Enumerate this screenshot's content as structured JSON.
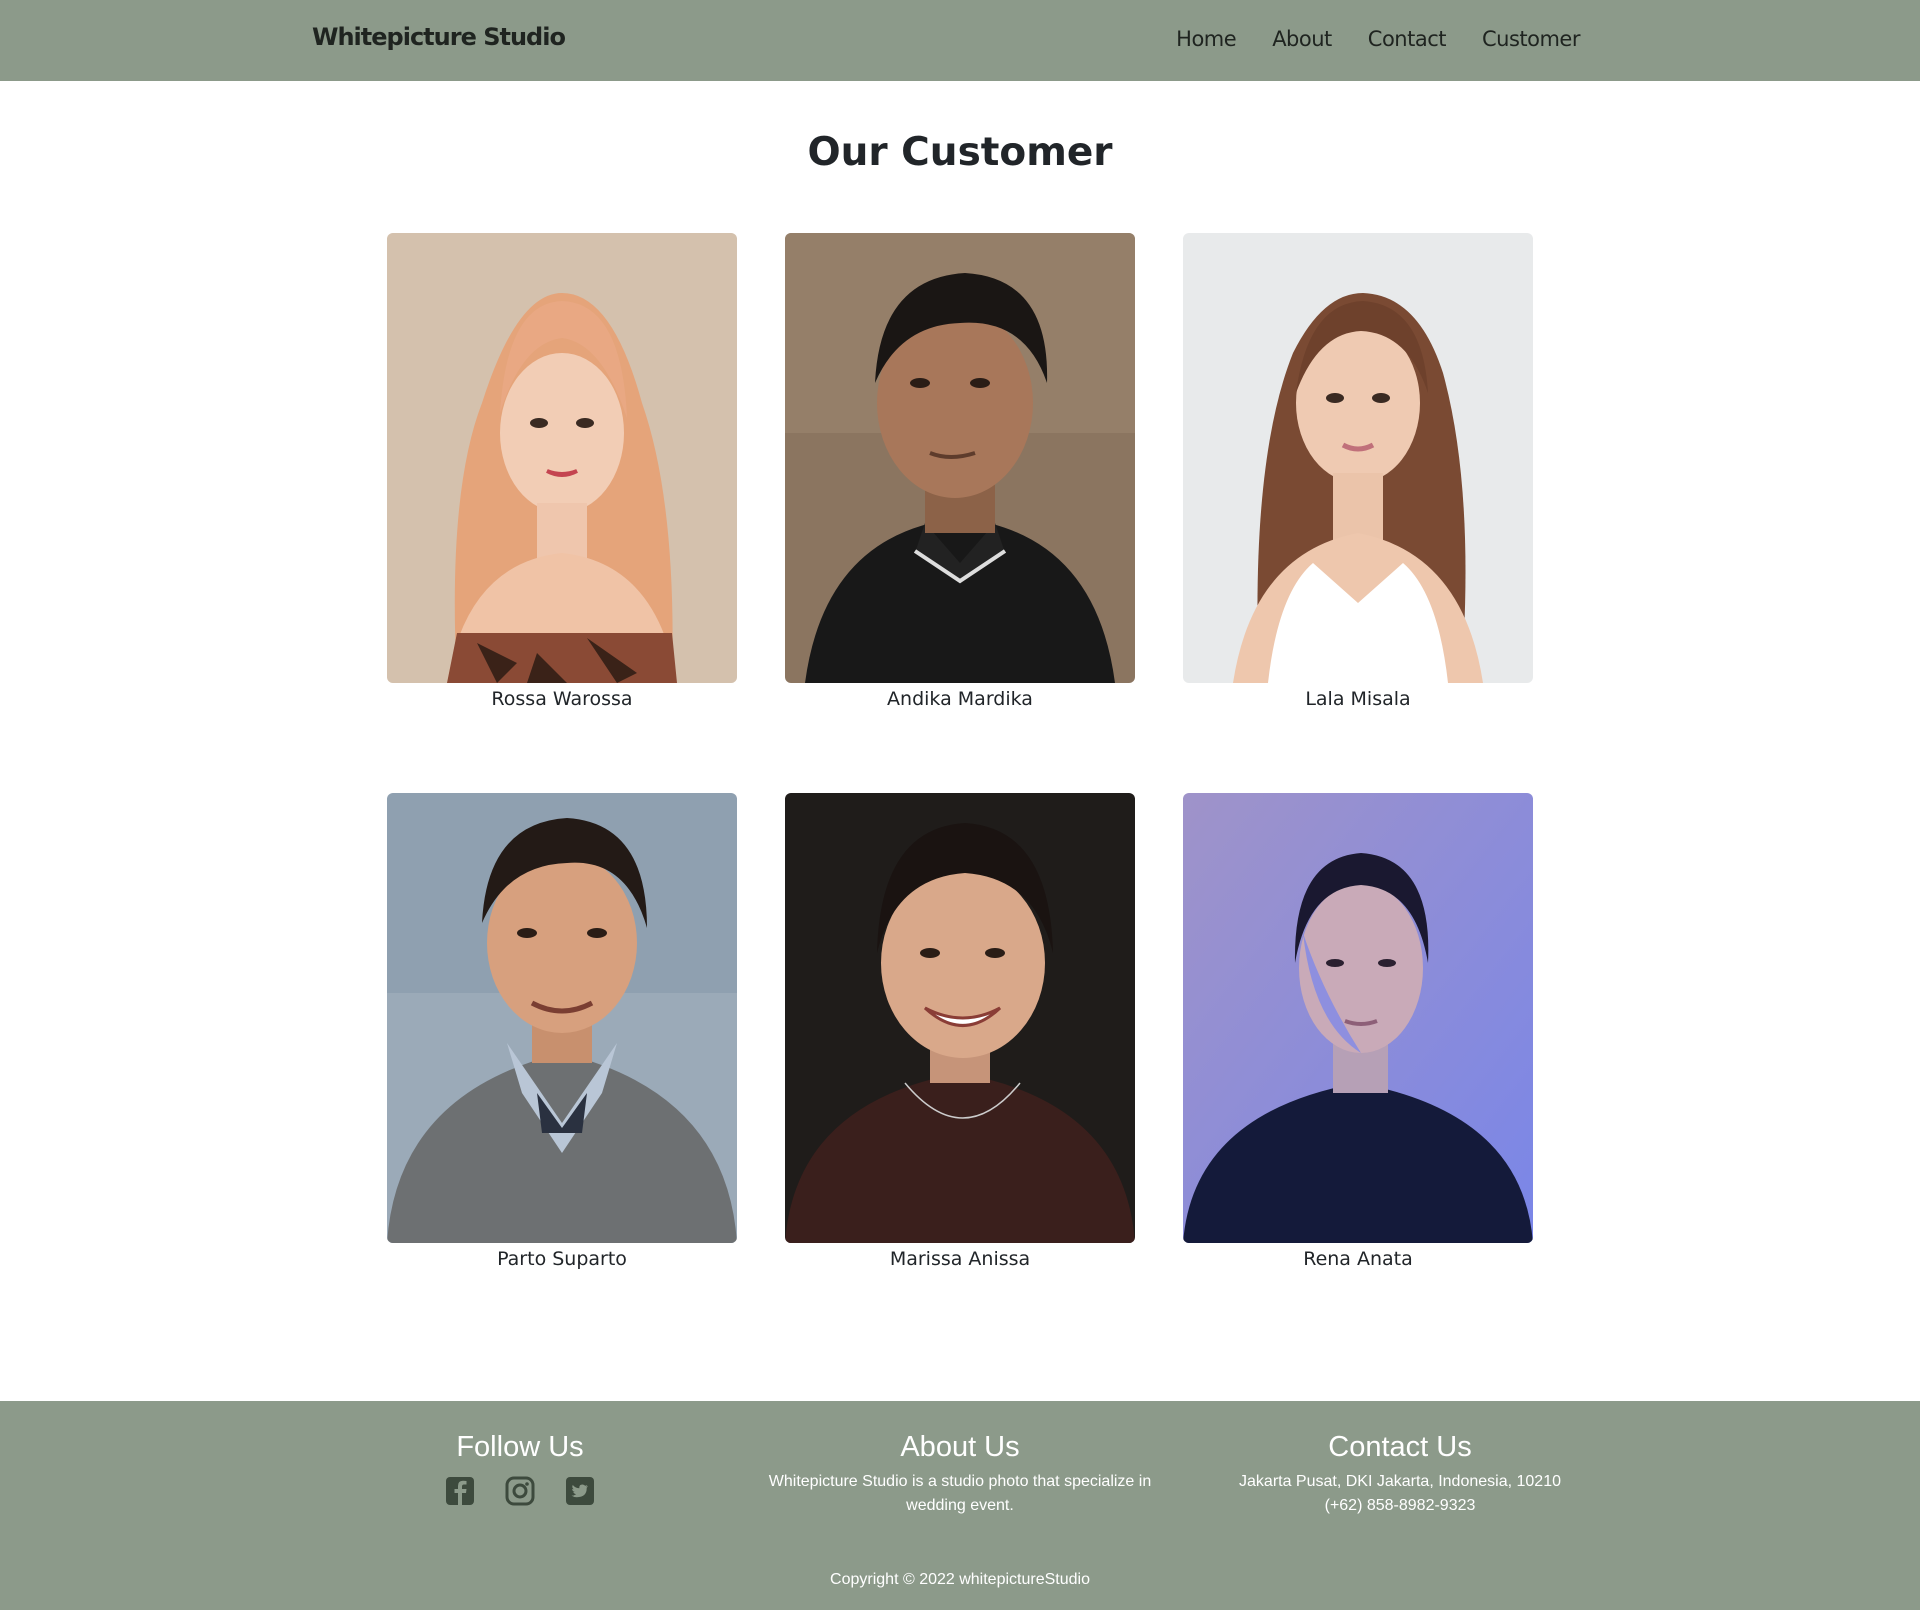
{
  "nav": {
    "brand": "Whitepicture Studio",
    "links": [
      "Home",
      "About",
      "Contact",
      "Customer"
    ]
  },
  "main": {
    "title": "Our Customer",
    "customers": [
      {
        "name": "Rossa Warossa"
      },
      {
        "name": "Andika Mardika"
      },
      {
        "name": "Lala Misala"
      },
      {
        "name": "Parto Suparto"
      },
      {
        "name": "Marissa Anissa"
      },
      {
        "name": "Rena Anata"
      }
    ]
  },
  "footer": {
    "follow_title": "Follow Us",
    "social_icons": [
      "facebook-icon",
      "instagram-icon",
      "twitter-icon"
    ],
    "about_title": "About Us",
    "about_text": "Whitepicture Studio is a studio photo that specialize in wedding event.",
    "contact_title": "Contact Us",
    "contact_address": "Jakarta Pusat, DKI Jakarta, Indonesia, 10210",
    "contact_phone": "(+62) 858-8982-9323",
    "copyright": "Copyright © 2022 whitepictureStudio"
  },
  "colors": {
    "navbar_bg": "#8c9a8a",
    "footer_bg": "#8c9a8a",
    "text_dark": "#212529"
  }
}
